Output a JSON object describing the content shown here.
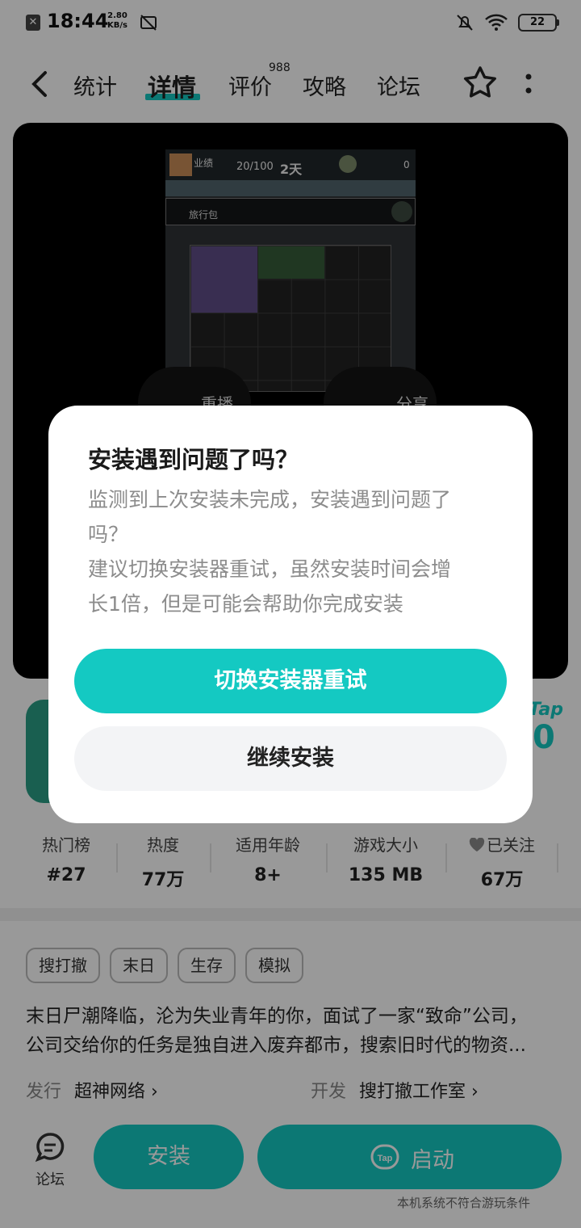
{
  "status_bar": {
    "time": "18:44",
    "speed_value": "2.80",
    "speed_unit": "KB/s",
    "battery": "22",
    "notification_icon": "x-notification-icon",
    "mute_icon": "bell-off-icon",
    "wifi_icon": "wifi-icon"
  },
  "nav": {
    "tabs": [
      {
        "label": "统计"
      },
      {
        "label": "详情"
      },
      {
        "label": "评价"
      },
      {
        "label": "攻略"
      },
      {
        "label": "论坛"
      }
    ],
    "active_tab": "详情",
    "review_count": "988"
  },
  "video": {
    "game_hud": {
      "label": "业绩",
      "score": "20/100",
      "days": "2天",
      "counter": "0",
      "bag": "旅行包"
    },
    "replay_label": "重播",
    "share_label": "分享"
  },
  "rating": {
    "badge": "Tap",
    "score_partial": "0"
  },
  "stats": [
    {
      "label": "热门榜",
      "value": "#27"
    },
    {
      "label": "热度",
      "value": "77万"
    },
    {
      "label": "适用年龄",
      "value": "8+"
    },
    {
      "label": "游戏大小",
      "value": "135 MB"
    },
    {
      "label": "已关注",
      "value": "67万"
    }
  ],
  "tags": [
    "搜打撤",
    "末日",
    "生存",
    "模拟"
  ],
  "description": {
    "line1": "末日尸潮降临，沦为失业青年的你，面试了一家“致命”公司，",
    "line2": "公司交给你的任务是独自进入废弃都市，搜索旧时代的物资..."
  },
  "publisher": {
    "label": "发行",
    "name": "超神网络"
  },
  "developer": {
    "label": "开发",
    "name": "搜打撤工作室"
  },
  "bottom_bar": {
    "forum_label": "论坛",
    "install_label": "安装",
    "launch_label": "启动",
    "note": "本机系统不符合游玩条件"
  },
  "dialog": {
    "title": "安装遇到问题了吗？",
    "body_line1": "监测到上次安装未完成，安装遇到问题了",
    "body_line2": "吗？",
    "body_line3": "建议切换安装器重试，虽然安装时间会增",
    "body_line4": "长1倍，但是可能会帮助你完成安装",
    "primary_button": "切换安装器重试",
    "secondary_button": "继续安装"
  },
  "colors": {
    "accent": "#14c9c2",
    "overlay": "rgba(0,0,0,0.4)"
  }
}
